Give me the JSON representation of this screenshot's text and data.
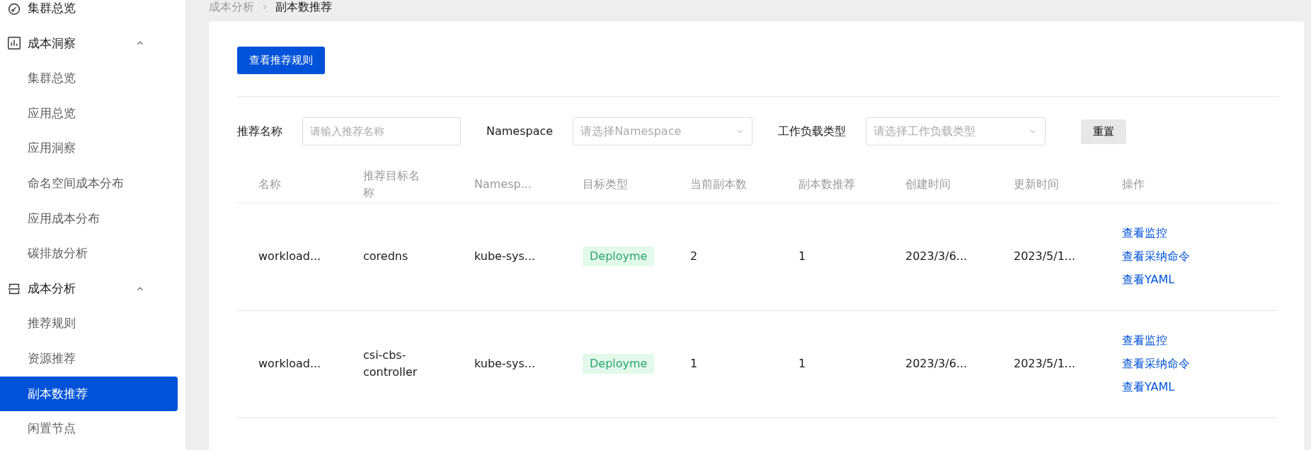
{
  "sidebar": {
    "items": [
      {
        "kind": "link",
        "label": "集群总览",
        "selected": false
      },
      {
        "kind": "group",
        "label": "成本洞察",
        "expanded": true,
        "children": [
          {
            "label": "集群总览",
            "selected": false
          },
          {
            "label": "应用总览",
            "selected": false
          },
          {
            "label": "应用洞察",
            "selected": false
          },
          {
            "label": "命名空间成本分布",
            "selected": false
          },
          {
            "label": "应用成本分布",
            "selected": false
          },
          {
            "label": "碳排放分析",
            "selected": false
          }
        ]
      },
      {
        "kind": "group",
        "label": "成本分析",
        "expanded": true,
        "children": [
          {
            "label": "推荐规则",
            "selected": false
          },
          {
            "label": "资源推荐",
            "selected": false
          },
          {
            "label": "副本数推荐",
            "selected": true
          },
          {
            "label": "闲置节点",
            "selected": false
          }
        ]
      }
    ]
  },
  "breadcrumb": [
    "成本分析",
    "副本数推荐"
  ],
  "primary_button": "查看推荐规则",
  "filters": [
    {
      "kind": "input",
      "label": "推荐名称",
      "placeholder": "请输入推荐名称"
    },
    {
      "kind": "select",
      "label": "Namespace",
      "placeholder": "请选择Namespace"
    },
    {
      "kind": "select",
      "label": "工作负载类型",
      "placeholder": "请选择工作负载类型"
    }
  ],
  "reset_button": "重置",
  "table": {
    "columns": [
      "名称",
      "推荐目标名称",
      "Namesp...",
      "目标类型",
      "当前副本数",
      "副本数推荐",
      "创建时间",
      "更新时间",
      "操作"
    ],
    "rows": [
      {
        "name": "workload...",
        "target": "coredns",
        "namespace": "kube-sys...",
        "type": "Deployme",
        "current": "2",
        "recommended": "1",
        "created": "2023/3/6...",
        "updated": "2023/5/1...",
        "actions": [
          "查看监控",
          "查看采纳命令",
          "查看YAML"
        ]
      },
      {
        "name": "workload...",
        "target": "csi-cbs-controller",
        "namespace": "kube-sys...",
        "type": "Deployme",
        "current": "1",
        "recommended": "1",
        "created": "2023/3/6...",
        "updated": "2023/5/1...",
        "actions": [
          "查看监控",
          "查看采纳命令",
          "查看YAML"
        ]
      }
    ]
  }
}
